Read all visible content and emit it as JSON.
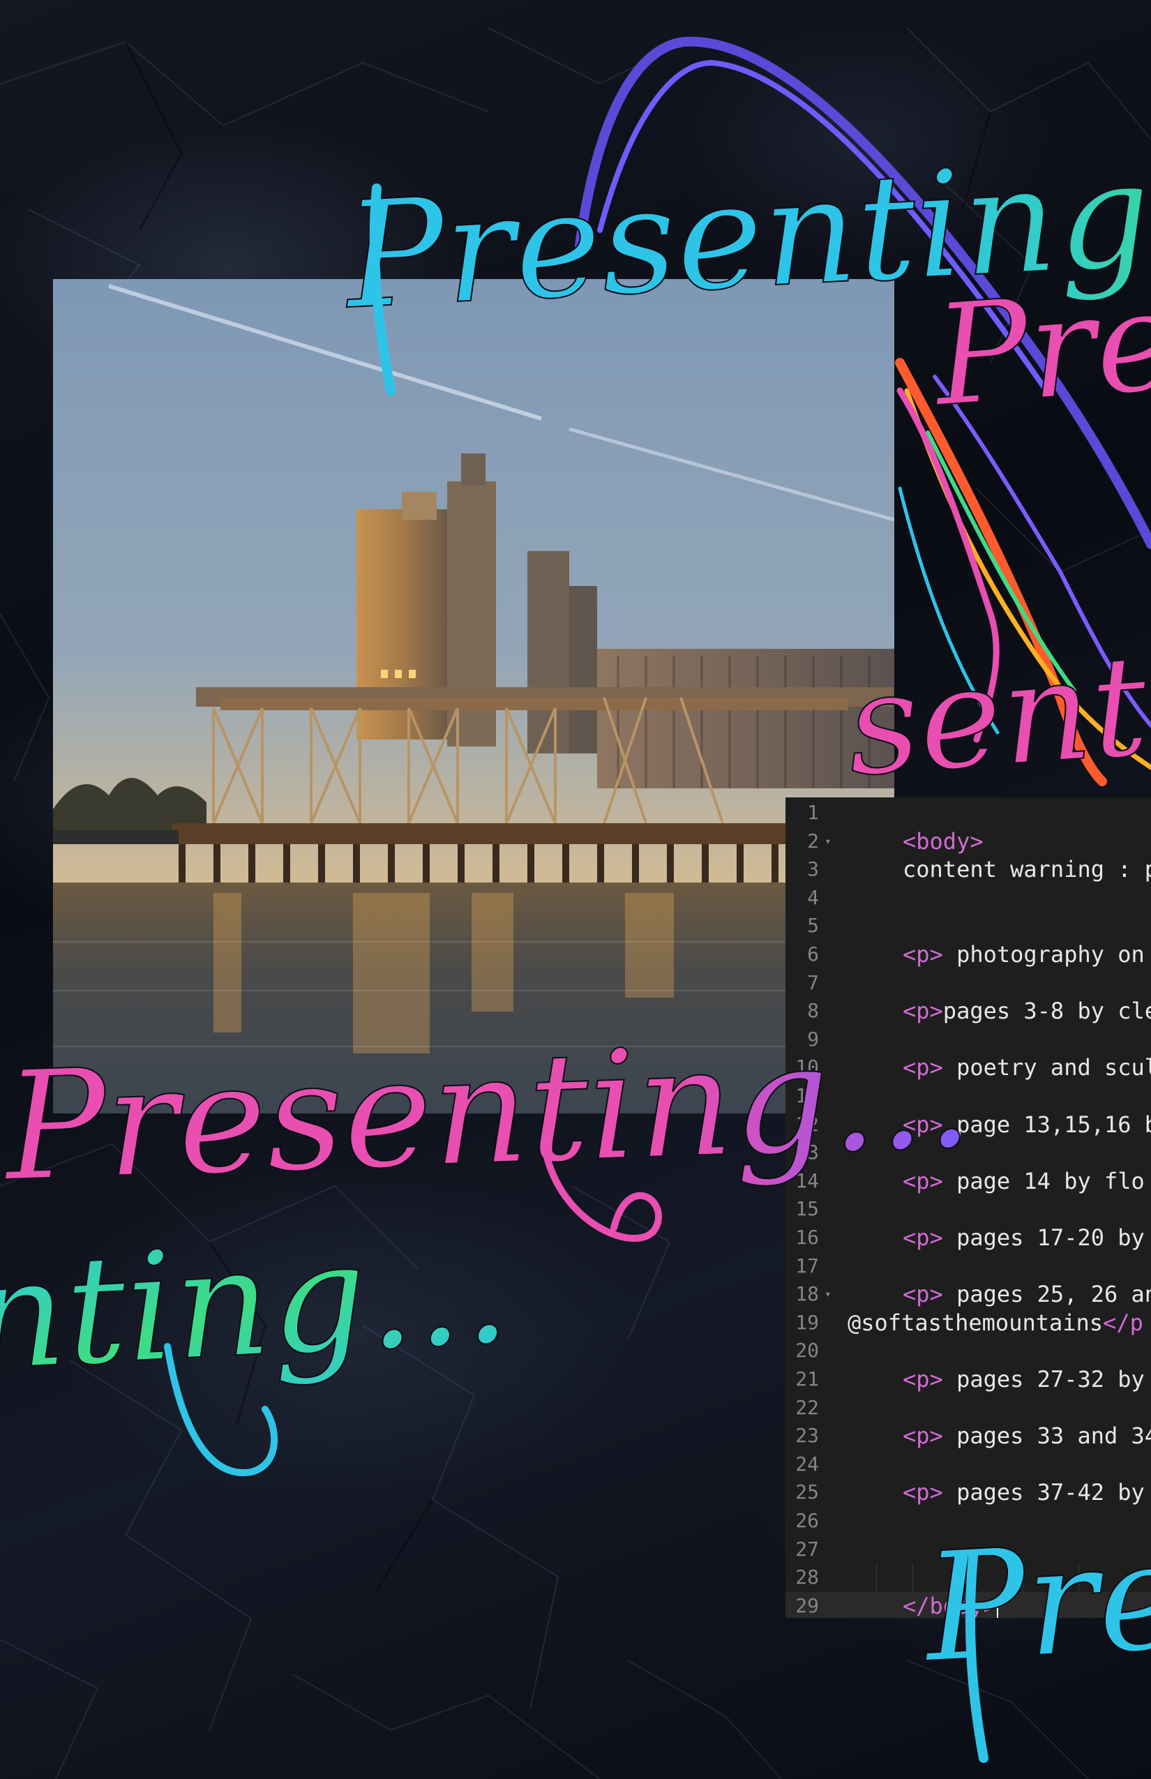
{
  "artwork": {
    "title_word": "Presenting",
    "ellipsis": "...",
    "colors": {
      "background": "#0b0d14",
      "cyan": "#2ec4e8",
      "pink": "#e84fb0",
      "green": "#3ddc84",
      "purple": "#7a5cff",
      "orange": "#ff6a2a",
      "yellow": "#f2d21a"
    }
  },
  "photo": {
    "subject": "industrial-grain-elevator-waterfront"
  },
  "editor": {
    "lines": [
      {
        "n": "1",
        "fold": "",
        "parts": []
      },
      {
        "n": "2",
        "fold": "▾",
        "parts": [
          {
            "t": "tag",
            "s": "<body>"
          }
        ]
      },
      {
        "n": "3",
        "fold": "",
        "parts": [
          {
            "t": "txt",
            "s": "content warning : p"
          }
        ]
      },
      {
        "n": "4",
        "fold": "",
        "parts": []
      },
      {
        "n": "5",
        "fold": "",
        "parts": []
      },
      {
        "n": "6",
        "fold": "",
        "parts": [
          {
            "t": "tag",
            "s": "<p>"
          },
          {
            "t": "txt",
            "s": " photography on"
          }
        ]
      },
      {
        "n": "7",
        "fold": "",
        "parts": []
      },
      {
        "n": "8",
        "fold": "",
        "parts": [
          {
            "t": "tag",
            "s": "<p>"
          },
          {
            "t": "txt",
            "s": "pages 3-8 by cle"
          }
        ]
      },
      {
        "n": "9",
        "fold": "",
        "parts": []
      },
      {
        "n": "10",
        "fold": "",
        "parts": [
          {
            "t": "tag",
            "s": "<p>"
          },
          {
            "t": "txt",
            "s": " poetry and scul"
          }
        ]
      },
      {
        "n": "11",
        "fold": "",
        "parts": []
      },
      {
        "n": "12",
        "fold": "",
        "parts": [
          {
            "t": "tag",
            "s": "<p>"
          },
          {
            "t": "txt",
            "s": " page 13,15,16 b"
          }
        ]
      },
      {
        "n": "13",
        "fold": "",
        "parts": []
      },
      {
        "n": "14",
        "fold": "",
        "parts": [
          {
            "t": "tag",
            "s": "<p>"
          },
          {
            "t": "txt",
            "s": " page 14 by flo"
          }
        ]
      },
      {
        "n": "15",
        "fold": "",
        "parts": []
      },
      {
        "n": "16",
        "fold": "",
        "parts": [
          {
            "t": "tag",
            "s": "<p>"
          },
          {
            "t": "txt",
            "s": " pages 17-20 by"
          }
        ]
      },
      {
        "n": "17",
        "fold": "",
        "parts": []
      },
      {
        "n": "18",
        "fold": "▾",
        "parts": [
          {
            "t": "tag",
            "s": "<p>"
          },
          {
            "t": "txt",
            "s": " pages 25, 26 an"
          }
        ]
      },
      {
        "n": "19",
        "fold": "",
        "wrap": true,
        "parts": [
          {
            "t": "txt",
            "s": "@softasthemountains"
          },
          {
            "t": "tag",
            "s": "</p"
          }
        ]
      },
      {
        "n": "20",
        "fold": "",
        "parts": []
      },
      {
        "n": "21",
        "fold": "",
        "parts": [
          {
            "t": "tag",
            "s": "<p>"
          },
          {
            "t": "txt",
            "s": " pages 27-32 by"
          }
        ]
      },
      {
        "n": "22",
        "fold": "",
        "parts": []
      },
      {
        "n": "23",
        "fold": "",
        "parts": [
          {
            "t": "tag",
            "s": "<p>"
          },
          {
            "t": "txt",
            "s": " pages 33 and 34"
          }
        ]
      },
      {
        "n": "24",
        "fold": "",
        "parts": []
      },
      {
        "n": "25",
        "fold": "",
        "parts": [
          {
            "t": "tag",
            "s": "<p>"
          },
          {
            "t": "txt",
            "s": " pages 37-42 by"
          }
        ]
      },
      {
        "n": "26",
        "fold": "",
        "parts": []
      },
      {
        "n": "27",
        "fold": "",
        "parts": []
      },
      {
        "n": "28",
        "fold": "",
        "parts": []
      },
      {
        "n": "29",
        "fold": "",
        "active": true,
        "cursor": true,
        "parts": [
          {
            "t": "tag",
            "s": "</body>"
          }
        ]
      }
    ]
  }
}
